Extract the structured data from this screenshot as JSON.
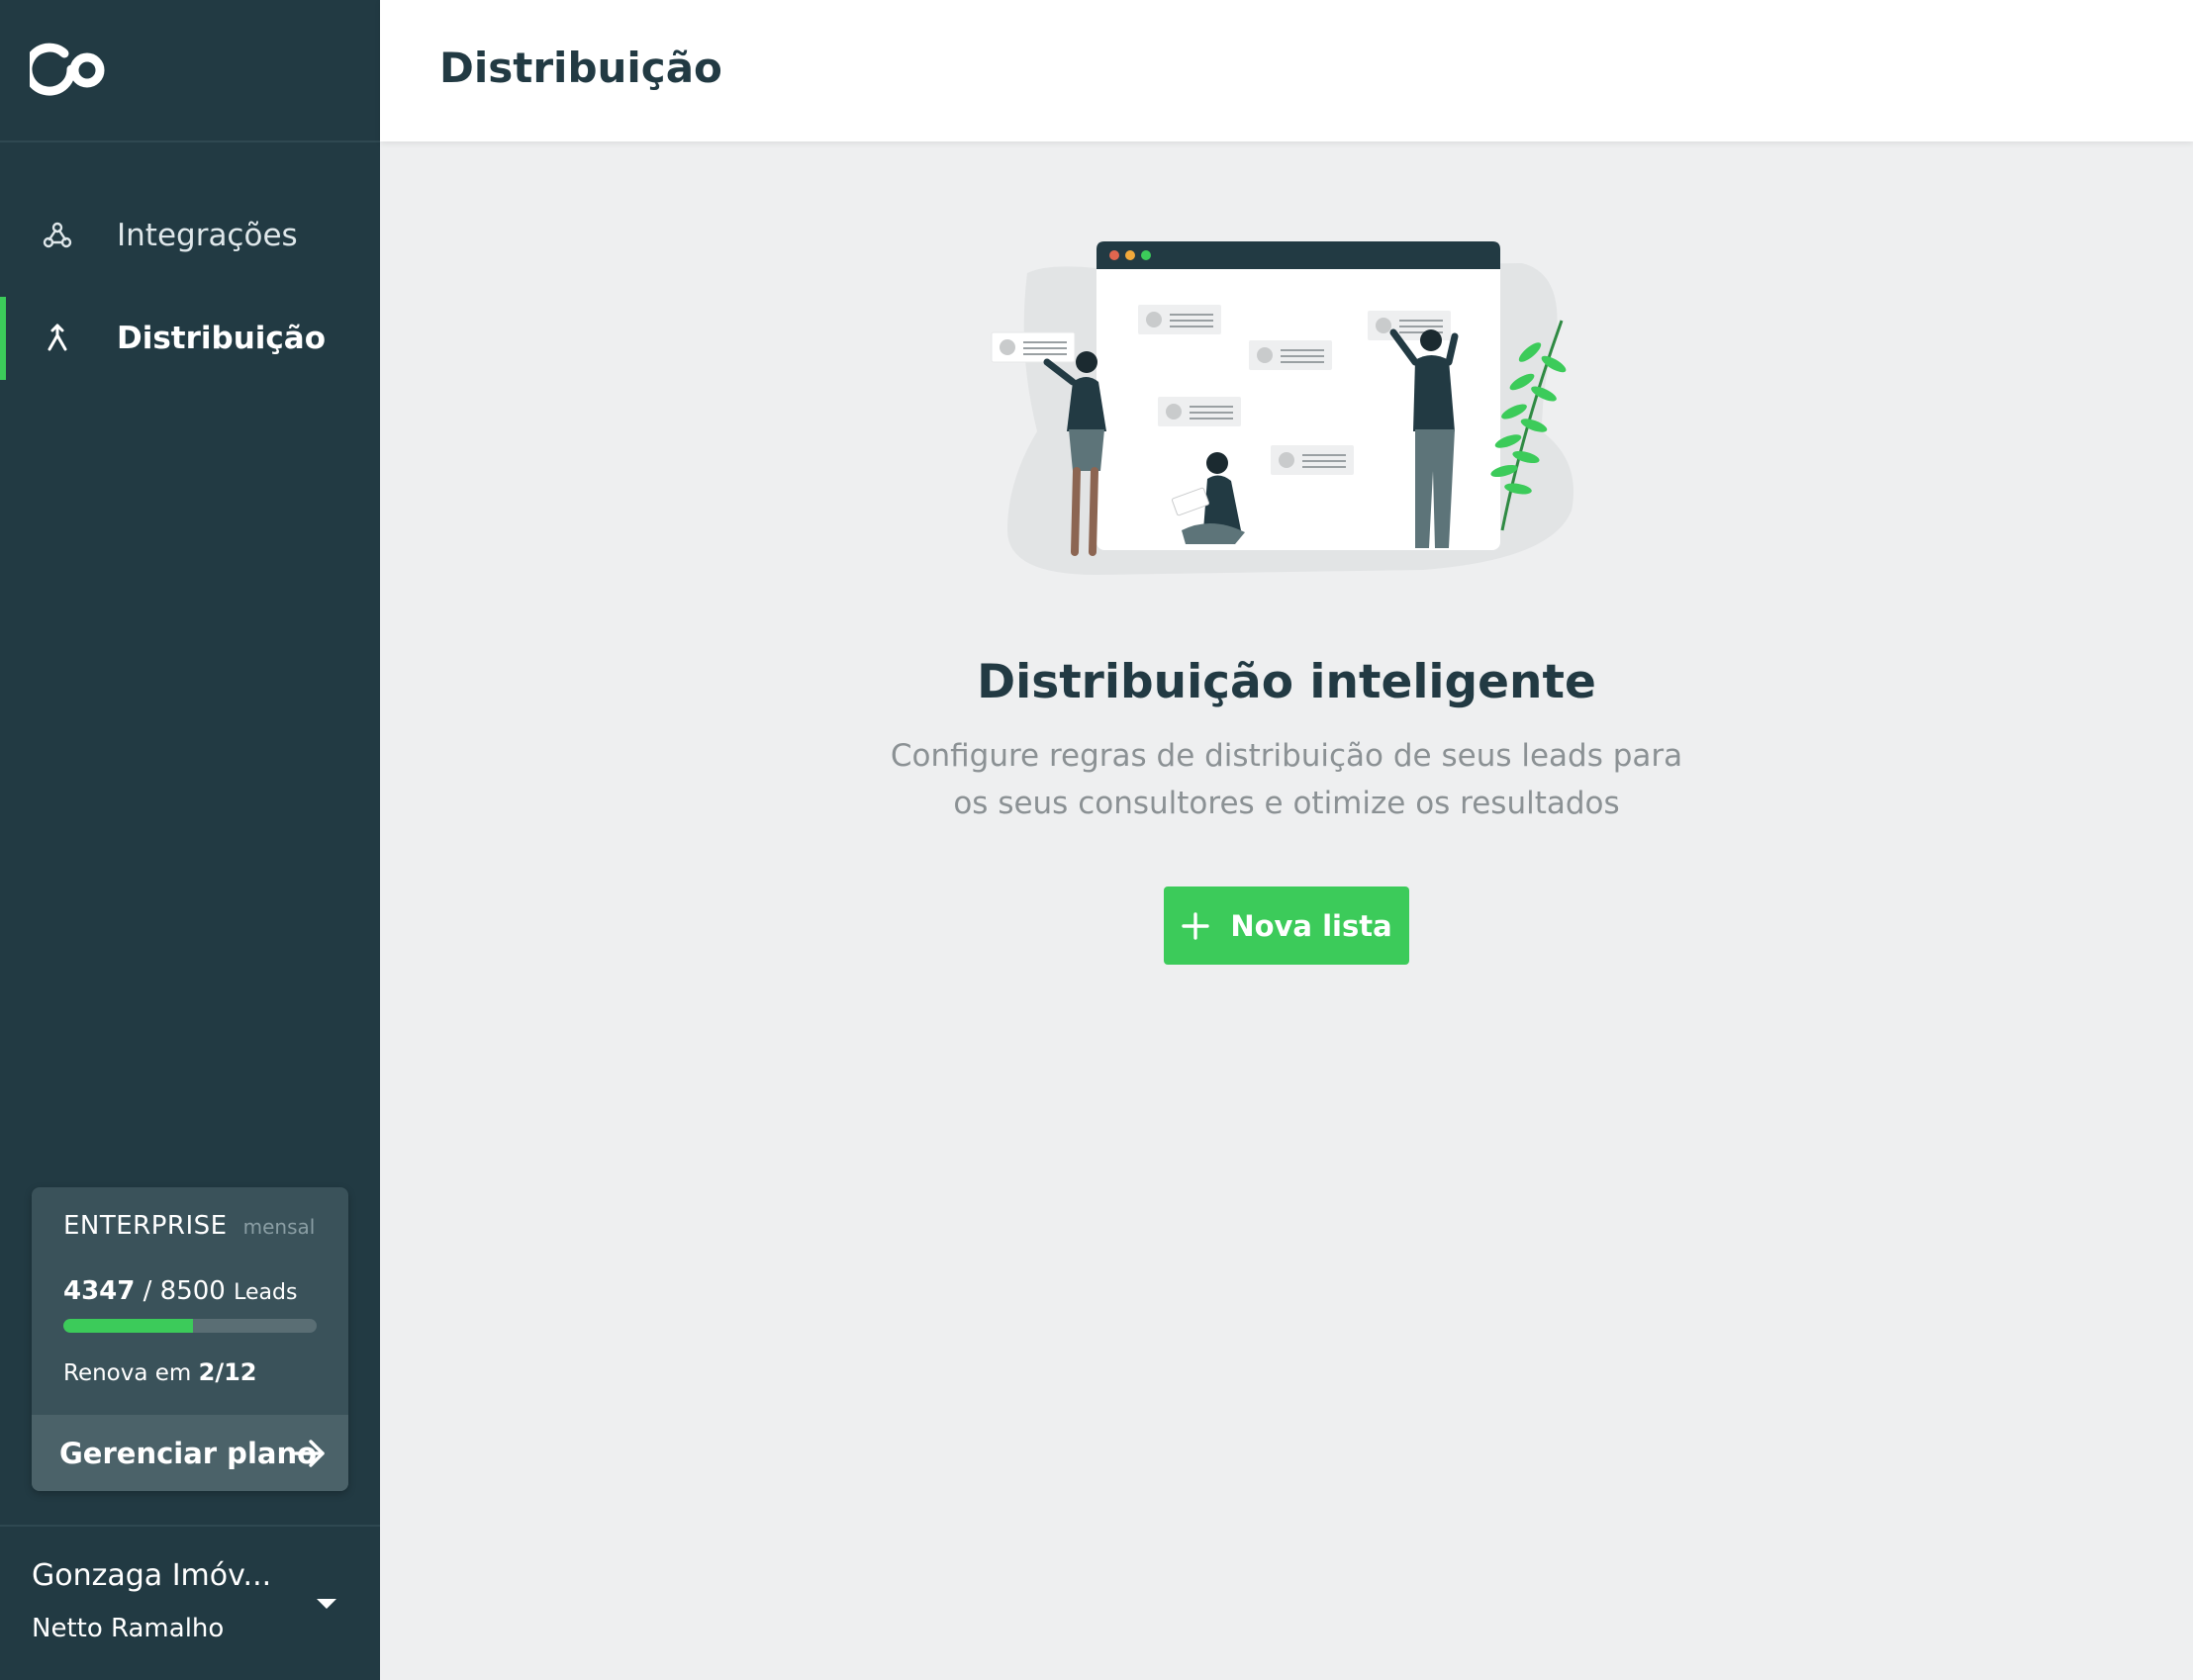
{
  "sidebar": {
    "logo_icon": "co-logo",
    "nav": [
      {
        "label": "Integrações",
        "icon": "webhook-icon",
        "active": false
      },
      {
        "label": "Distribuição",
        "icon": "split-arrow-icon",
        "active": true
      }
    ],
    "plan": {
      "name": "ENTERPRISE",
      "period": "mensal",
      "used": "4347",
      "separator": "/",
      "limit": "8500",
      "unit": "Leads",
      "usage_fraction": 0.511,
      "renew_prefix": "Renova em",
      "renew_date": "2/12",
      "manage_label": "Gerenciar plano",
      "manage_icon": "arrow-right-icon"
    },
    "account": {
      "company": "Gonzaga Imóv...",
      "user": "Netto Ramalho",
      "icon": "caret-down-icon"
    }
  },
  "header": {
    "title": "Distribuição"
  },
  "main": {
    "illustration": "team-organizing-board-illustration",
    "title": "Distribuição inteligente",
    "description_line1": "Configure regras de distribuição de seus leads para",
    "description_line2": "os seus consultores e otimize os resultados",
    "button_label": "Nova lista",
    "button_icon": "plus-icon"
  },
  "colors": {
    "sidebar_bg": "#223a43",
    "accent": "#3ccb5a",
    "page_bg": "#eeeff0",
    "card_bg": "#3a525a",
    "title_text": "#223a43",
    "muted_text": "#8b9194"
  }
}
